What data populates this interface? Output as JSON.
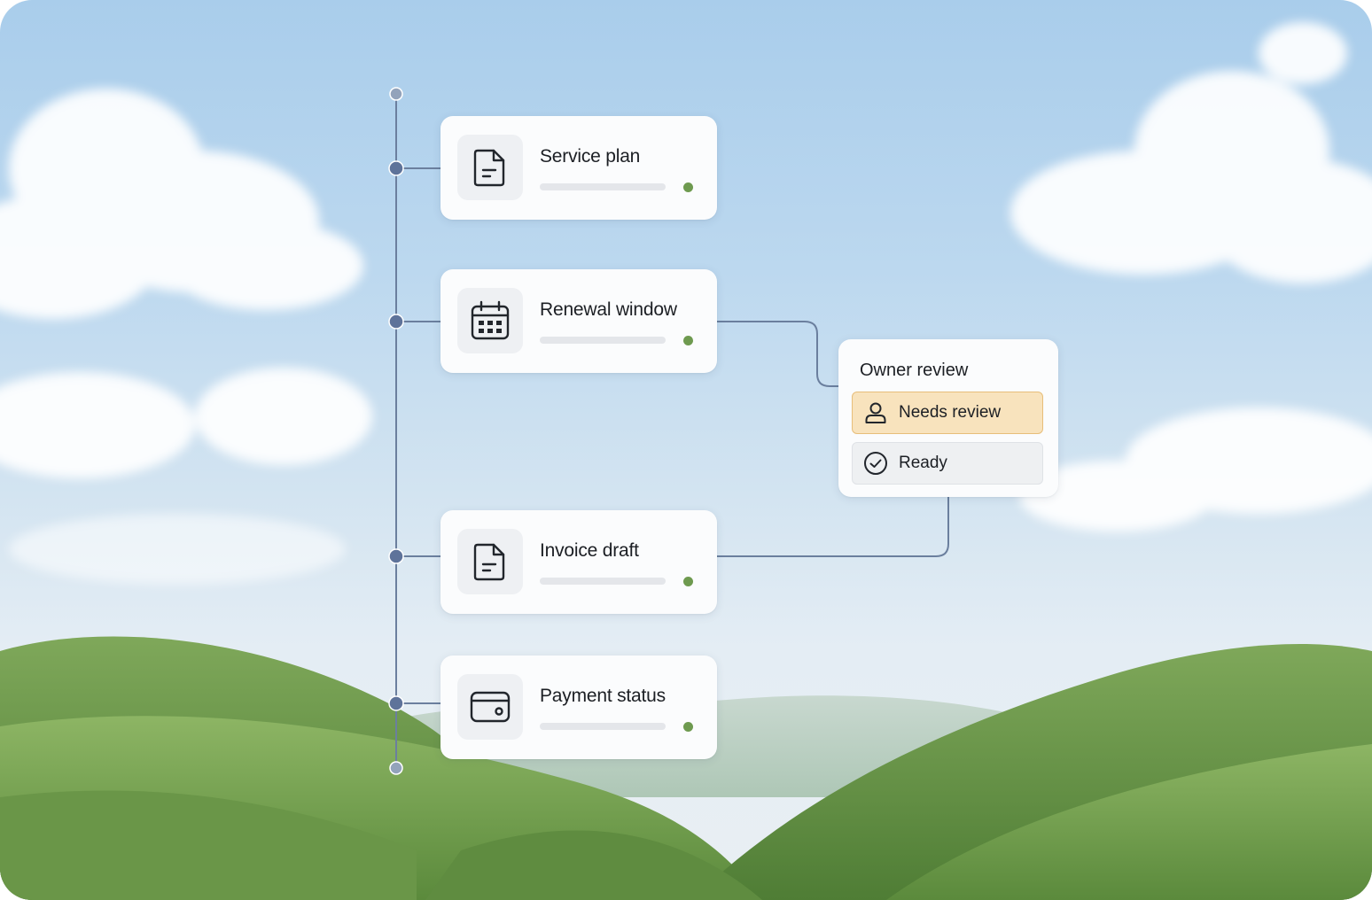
{
  "workflow": {
    "steps": [
      {
        "label": "Service plan",
        "icon": "document-icon",
        "status_color": "#6e9a4f"
      },
      {
        "label": "Renewal window",
        "icon": "calendar-icon",
        "status_color": "#6e9a4f"
      },
      {
        "label": "Invoice draft",
        "icon": "document-icon",
        "status_color": "#6e9a4f"
      },
      {
        "label": "Payment status",
        "icon": "wallet-icon",
        "status_color": "#6e9a4f"
      }
    ]
  },
  "owner_review": {
    "title": "Owner review",
    "options": [
      {
        "label": "Needs review",
        "icon": "user-icon",
        "selected": true
      },
      {
        "label": "Ready",
        "icon": "check-circle-icon",
        "selected": false
      }
    ]
  },
  "colors": {
    "connector": "#6b7f9e",
    "status_dot": "#6e9a4f",
    "highlight": "#f8e3bd"
  }
}
